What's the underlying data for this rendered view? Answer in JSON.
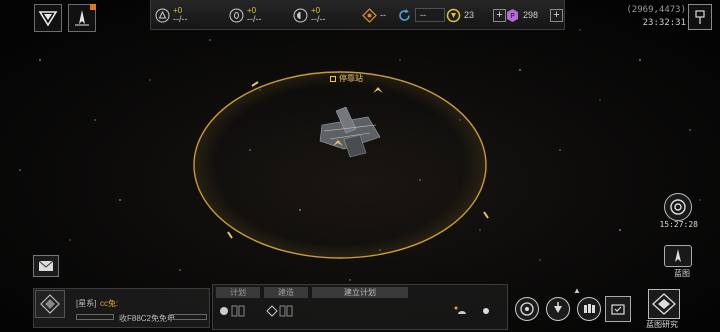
{
  "top": {
    "resources": [
      {
        "icon": "triangle-circle-icon",
        "gain": "+0",
        "amount": "--/--"
      },
      {
        "icon": "zero-circle-icon",
        "gain": "+0",
        "amount": "--/--"
      },
      {
        "icon": "half-circle-icon",
        "gain": "+0",
        "amount": "--/--"
      }
    ],
    "status": [
      {
        "icon": "diamond-icon",
        "value": "--"
      },
      {
        "icon": "refresh-icon",
        "value": "--"
      }
    ],
    "currency_gold": "23",
    "currency_purple": "298",
    "coords": "(2969,4473)",
    "time": "23:32:31"
  },
  "map": {
    "structure_label": "停靠站"
  },
  "right": {
    "timer": "15:27:28",
    "blueprint_label": "蓝图"
  },
  "chat": {
    "channel": "[星系]",
    "sender": "cc兔:",
    "message": "收F88C2免免申"
  },
  "plan": {
    "tab_plan": "计划",
    "tab_build": "建造",
    "tab_create": "建立计划"
  },
  "bottom": {
    "research_label": "蓝图研究"
  },
  "colors": {
    "ring": "#c89a3c",
    "accent": "#e6c56a",
    "currency_gold": "#e0c040",
    "currency_purple": "#b56ad8"
  }
}
